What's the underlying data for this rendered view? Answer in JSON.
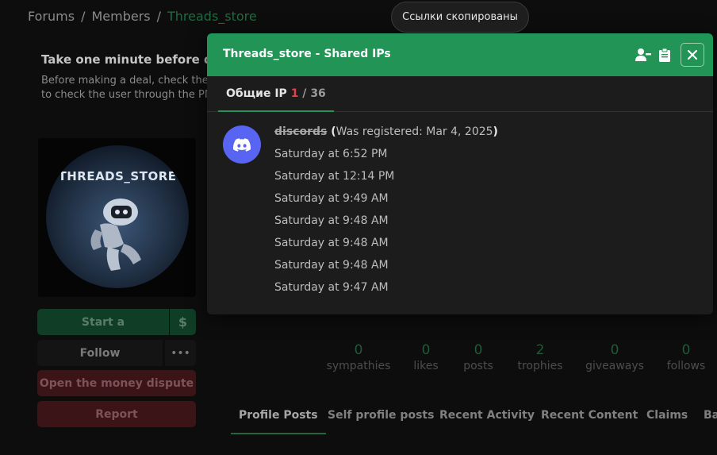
{
  "breadcrumb": {
    "items": [
      "Forums",
      "Members",
      "Threads_store"
    ],
    "separator": "/"
  },
  "notice": {
    "title": "Take one minute before de",
    "line1": "Before making a deal, check the",
    "line2": "to check the user through the PM"
  },
  "profile": {
    "avatar_logo": "THREADS_STORE",
    "buttons": {
      "start": "Start a",
      "start_icon": "$",
      "follow": "Follow",
      "more": "•••",
      "dispute": "Open the money dispute",
      "report": "Report"
    },
    "stats": [
      {
        "num": "0",
        "label": "sympathies"
      },
      {
        "num": "0",
        "label": "likes"
      },
      {
        "num": "0",
        "label": "posts"
      },
      {
        "num": "2",
        "label": "trophies"
      },
      {
        "num": "0",
        "label": "giveaways"
      },
      {
        "num": "0",
        "label": "follows"
      }
    ],
    "tabs": [
      "Profile Posts",
      "Self profile posts",
      "Recent Activity",
      "Recent Content",
      "Claims",
      "Ba"
    ]
  },
  "toast": {
    "text": "Ссылки скопированы"
  },
  "modal": {
    "title": "Threads_store - Shared IPs",
    "icons": [
      "user-minus-icon",
      "clipboard-icon",
      "close-icon"
    ],
    "tab": {
      "label": "Общие IP",
      "current": "1",
      "separator": " / ",
      "total": "36"
    },
    "entry": {
      "username": "discords",
      "registered_open": " (",
      "registered": "Was registered: Mar 4, 2025",
      "registered_close": ")",
      "timestamps": [
        "Saturday at 6:52 PM",
        "Saturday at 12:14 PM",
        "Saturday at 9:49 AM",
        "Saturday at 9:48 AM",
        "Saturday at 9:48 AM",
        "Saturday at 9:48 AM",
        "Saturday at 9:47 AM"
      ]
    }
  },
  "colors": {
    "accent": "#219456",
    "discord": "#5865f2",
    "counter_red": "#e0424a"
  }
}
